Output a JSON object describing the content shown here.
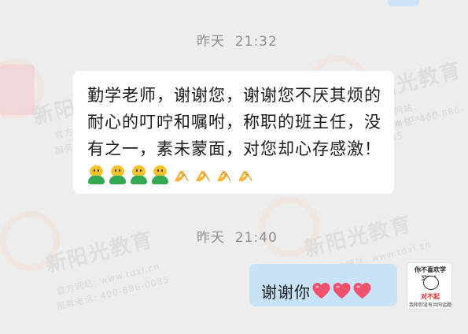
{
  "conversation": {
    "messages": [
      {
        "timestamp": "昨天  21:32",
        "sender": "other",
        "text": "勤学老师，谢谢您，谢谢您不厌其烦的耐心的叮咛和嘱咐，称职的班主任，没有之一，素未蒙面，对您却心存感激！",
        "emojis": [
          "smile-emoji",
          "smile-emoji",
          "smile-emoji",
          "smile-emoji",
          "pray-emoji",
          "pray-emoji",
          "pray-emoji",
          "pray-emoji"
        ]
      },
      {
        "timestamp": "昨天  21:40",
        "sender": "self",
        "text": "谢谢你",
        "emojis": [
          "heart-emoji",
          "heart-emoji",
          "heart-emoji"
        ]
      }
    ]
  },
  "avatar_self": {
    "caption_top": "你不喜欢学习？！",
    "caption_mid": "对不起",
    "caption_bottom": "我和你没有共同话题"
  },
  "watermark": {
    "logo": "新阳光教育",
    "line1": "官方网站: www.tdxl.cn",
    "line2": "服务电话: 400-886-0085"
  },
  "colors": {
    "background": "#ededed",
    "bubble_other": "#ffffff",
    "bubble_self": "#c8e2f8",
    "timestamp": "#8f8f8f"
  }
}
